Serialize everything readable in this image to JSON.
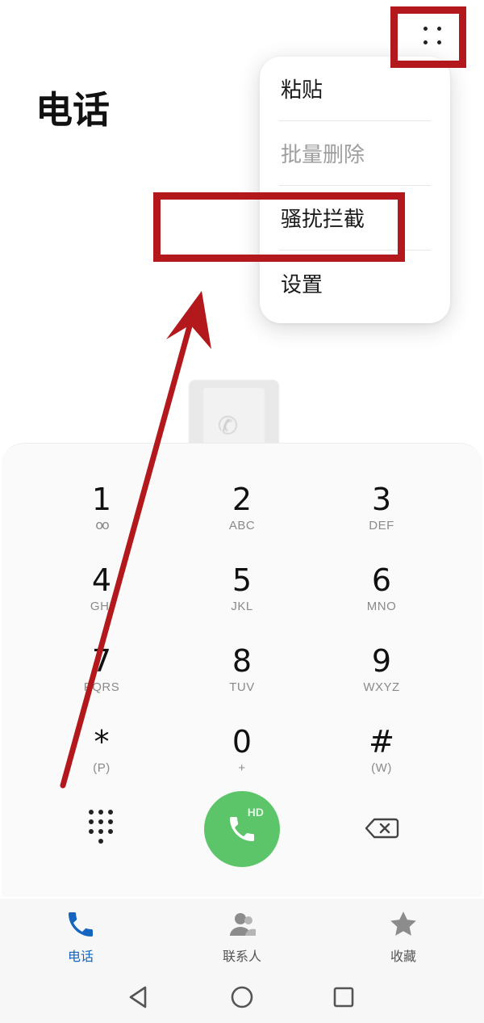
{
  "header": {
    "title": "电话"
  },
  "menu": {
    "items": [
      {
        "label": "粘贴",
        "enabled": true
      },
      {
        "label": "批量删除",
        "enabled": false
      },
      {
        "label": "骚扰拦截",
        "enabled": true
      },
      {
        "label": "设置",
        "enabled": true
      }
    ]
  },
  "dialpad": {
    "keys": [
      {
        "digit": "1",
        "letters": "ᴏᴏ"
      },
      {
        "digit": "2",
        "letters": "ABC"
      },
      {
        "digit": "3",
        "letters": "DEF"
      },
      {
        "digit": "4",
        "letters": "GHI"
      },
      {
        "digit": "5",
        "letters": "JKL"
      },
      {
        "digit": "6",
        "letters": "MNO"
      },
      {
        "digit": "7",
        "letters": "PQRS"
      },
      {
        "digit": "8",
        "letters": "TUV"
      },
      {
        "digit": "9",
        "letters": "WXYZ"
      },
      {
        "digit": "*",
        "letters": "(P)"
      },
      {
        "digit": "0",
        "letters": "+"
      },
      {
        "digit": "#",
        "letters": "(W)"
      }
    ],
    "call_badge": "HD"
  },
  "tabs": [
    {
      "label": "电话",
      "icon": "phone-icon",
      "active": true
    },
    {
      "label": "联系人",
      "icon": "contacts-icon",
      "active": false
    },
    {
      "label": "收藏",
      "icon": "star-icon",
      "active": false
    }
  ],
  "colors": {
    "accent": "#1565c0",
    "call_green": "#5cc569",
    "annotation_red": "#b3191c"
  }
}
